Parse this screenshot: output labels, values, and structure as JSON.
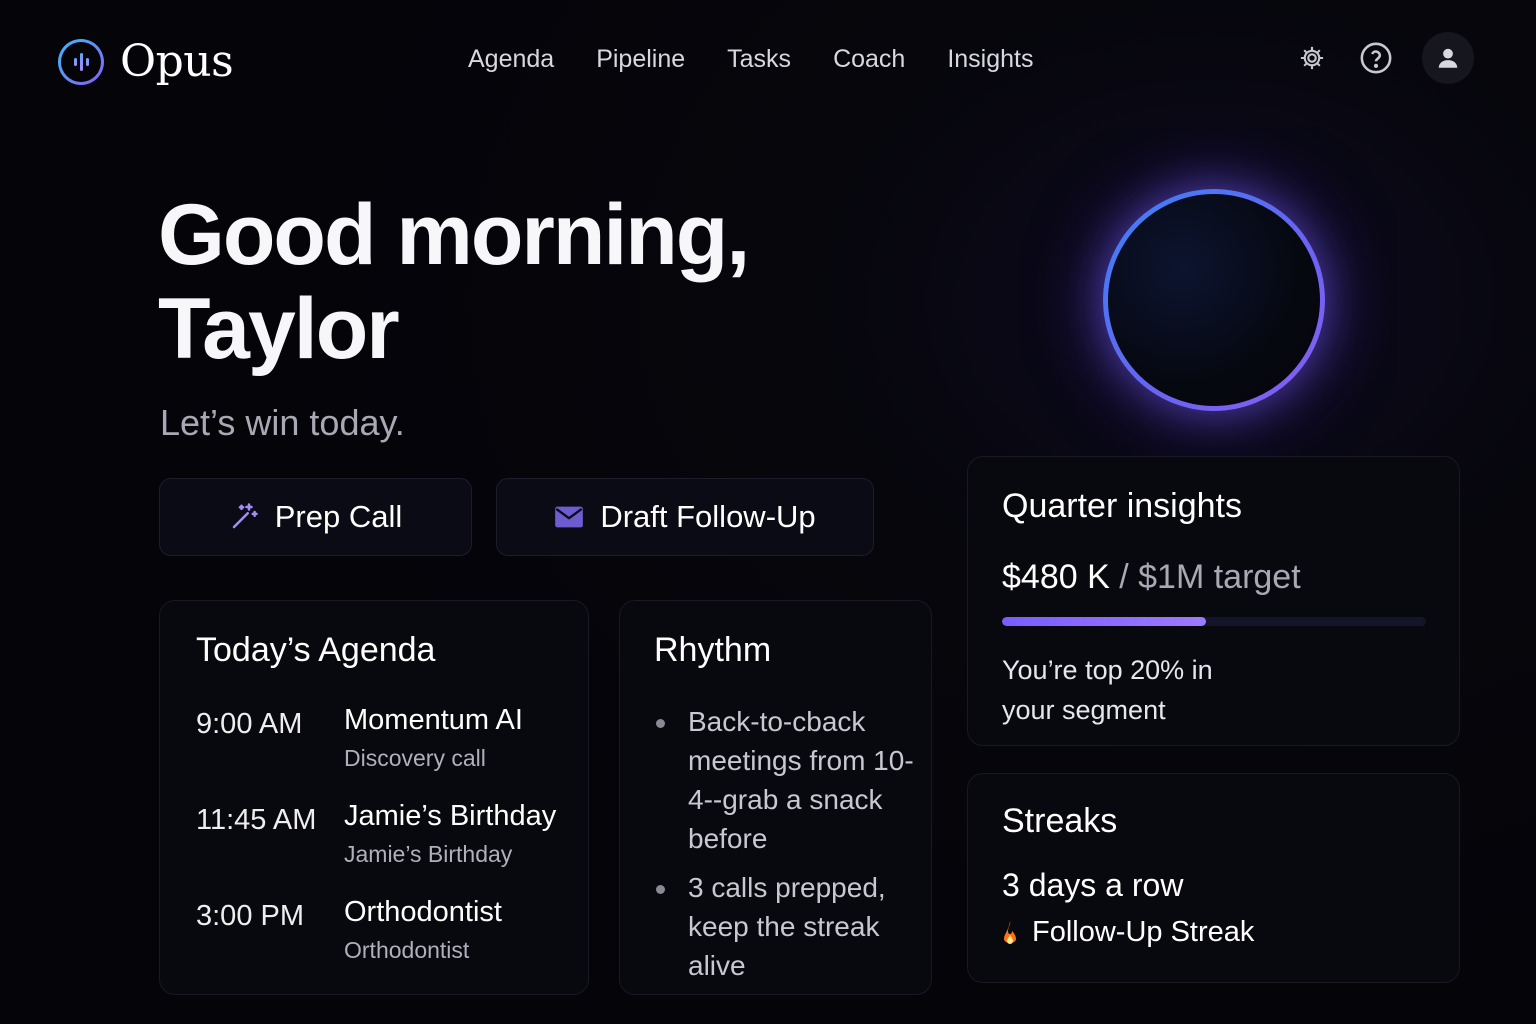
{
  "app": {
    "name": "Opus"
  },
  "nav": {
    "items": [
      {
        "label": "Agenda"
      },
      {
        "label": "Pipeline"
      },
      {
        "label": "Tasks"
      },
      {
        "label": "Coach"
      },
      {
        "label": "Insights"
      }
    ]
  },
  "header_icons": [
    "gear-icon",
    "help-icon",
    "user-icon"
  ],
  "hero": {
    "greeting_line1": "Good morning,",
    "greeting_line2": "Taylor",
    "subtitle": "Let’s win today."
  },
  "actions": {
    "prep_label": "Prep Call",
    "prep_icon": "magic-wand-icon",
    "draft_label": "Draft Follow-Up",
    "draft_icon": "mail-icon"
  },
  "agenda": {
    "title": "Today’s Agenda",
    "items": [
      {
        "time": "9:00 AM",
        "title": "Momentum AI",
        "subtitle": "Discovery call"
      },
      {
        "time": "11:45 AM",
        "title": "Jamie’s Birthday",
        "subtitle": "Jamie’s Birthday"
      },
      {
        "time": "3:00 PM",
        "title": "Orthodontist",
        "subtitle": "Orthodontist"
      }
    ]
  },
  "rhythm": {
    "title": "Rhythm",
    "items": [
      "Back-to-cback meetings from 10-4--grab a snack before",
      "3 calls prepped, keep the streak alive"
    ]
  },
  "insights": {
    "title": "Quarter insights",
    "amount": "$480 K",
    "separator": "/",
    "target": "$1M target",
    "progress": 0.48,
    "note": "You’re top 20% in your segment"
  },
  "streaks": {
    "title": "Streaks",
    "days": "3 days a row",
    "name": "Follow-Up Streak",
    "icon": "flame-icon"
  },
  "colors": {
    "background": "#040409",
    "accent_purple": "#9b7bff",
    "accent_blue": "#3b82f6",
    "flame": "#f97316"
  }
}
